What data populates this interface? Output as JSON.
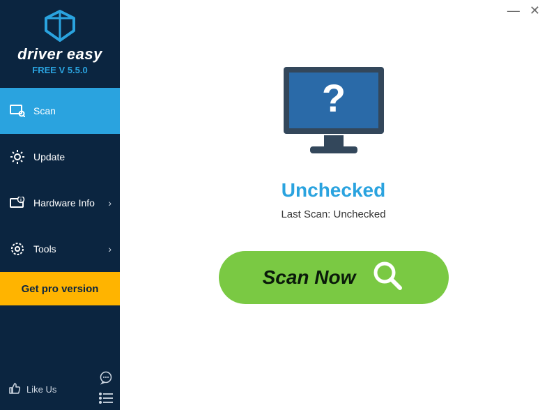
{
  "brand": {
    "name": "driver easy",
    "version": "FREE V 5.5.0"
  },
  "nav": {
    "scan": "Scan",
    "update": "Update",
    "hardware_info": "Hardware Info",
    "tools": "Tools"
  },
  "get_pro": "Get pro version",
  "like_us": "Like Us",
  "window": {
    "minimize": "—",
    "close": "✕"
  },
  "status": {
    "title": "Unchecked",
    "last_scan_label": "Last Scan: ",
    "last_scan_value": "Unchecked"
  },
  "scan_button": "Scan Now",
  "chevron": "›"
}
